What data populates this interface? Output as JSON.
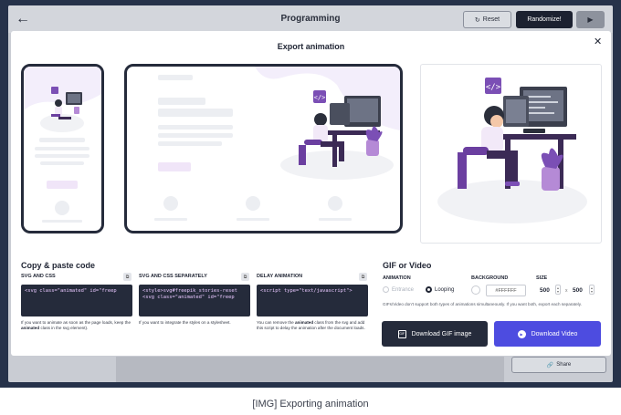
{
  "app": {
    "title": "Programming",
    "reset_label": "Reset",
    "randomize_label": "Randomize!",
    "share_label": "Share"
  },
  "modal": {
    "title": "Export animation",
    "close_label": "✕"
  },
  "copy_section": {
    "title": "Copy & paste code",
    "blocks": [
      {
        "label": "SVG AND CSS",
        "code_lines": [
          "<svg class=\"animated\" id=\"freep"
        ],
        "help": [
          "If you want to animate as soon as the page loads, keep the ",
          "animated",
          " class in the svg element)."
        ]
      },
      {
        "label": "SVG AND CSS SEPARATELY",
        "code_lines": [
          "<style>svg#freepik_stories-reset",
          "<svg class=\"animated\" id=\"freep"
        ],
        "help": [
          "If you want to integrate the styles on a stylesheet.",
          "",
          ""
        ]
      },
      {
        "label": "DELAY ANIMATION",
        "code_lines": [
          "<script type=\"text/javascript\">"
        ],
        "help": [
          "You can remove the ",
          "animated",
          " class from the svg and add this script to delay the animation after the document loads."
        ]
      }
    ]
  },
  "gif_section": {
    "title": "GIF or Video",
    "animation_label": "ANIMATION",
    "options": [
      "Entrance",
      "Looping"
    ],
    "selected_option": "Looping",
    "background_label": "BACKGROUND",
    "background_value": "#FFFFFF",
    "size_label": "SIZE",
    "width": "500",
    "height": "500",
    "times": "x",
    "note": "GIFs/Video don't support both types of animations simultaneously. If you want both, export each separately.",
    "download_gif_label": "Download GIF image",
    "download_video_label": "Download Video"
  },
  "caption": "[IMG] Exporting animation",
  "colors": {
    "accent": "#4d4ce0",
    "dark": "#252b3b",
    "illustration_purple": "#6b3fa0"
  }
}
